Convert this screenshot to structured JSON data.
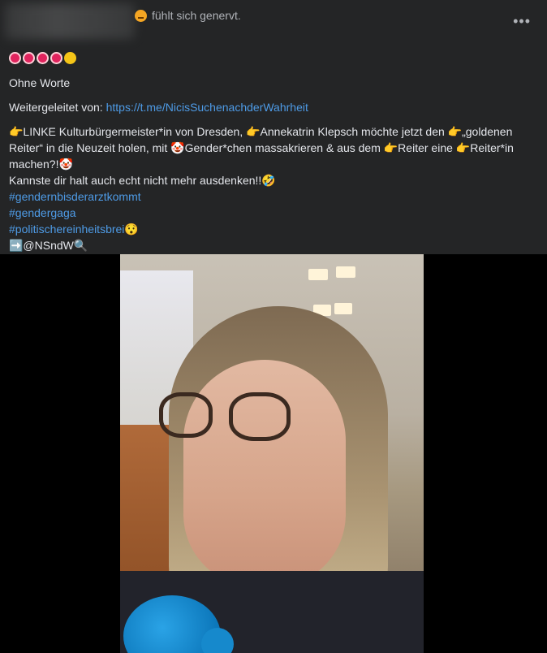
{
  "header": {
    "feeling": "fühlt sich genervt.",
    "feeling_icon": "angry-face-icon",
    "more_label": "•••"
  },
  "post": {
    "emoji_line_icons": [
      "alarm-clock-icon",
      "alarm-clock-icon",
      "alarm-clock-icon",
      "alarm-clock-icon",
      "flushed-face-icon"
    ],
    "line1": "Ohne Worte",
    "forward_label": "Weitergeleitet von: ",
    "forward_link": "https://t.me/NicisSuchenachderWahrheit",
    "para1": "👉LINKE Kulturbürgermeister*in von Dresden, 👉Annekatrin Klepsch möchte jetzt den 👉„goldenen Reiter“ in die Neuzeit holen, mit 🤡Gender*chen massakrieren & aus dem 👉Reiter eine 👉Reiter*in machen?!🤡",
    "para2": "Kannste dir halt auch echt nicht mehr ausdenken!!🤣",
    "hashtags": [
      "#gendernbisderarztkommt",
      "#gendergaga",
      "#politischereinheitsbrei😯"
    ],
    "mention": "➡️@NSndW🔍"
  },
  "colors": {
    "background": "#242526",
    "text": "#e4e6eb",
    "link": "#4e9be6"
  }
}
